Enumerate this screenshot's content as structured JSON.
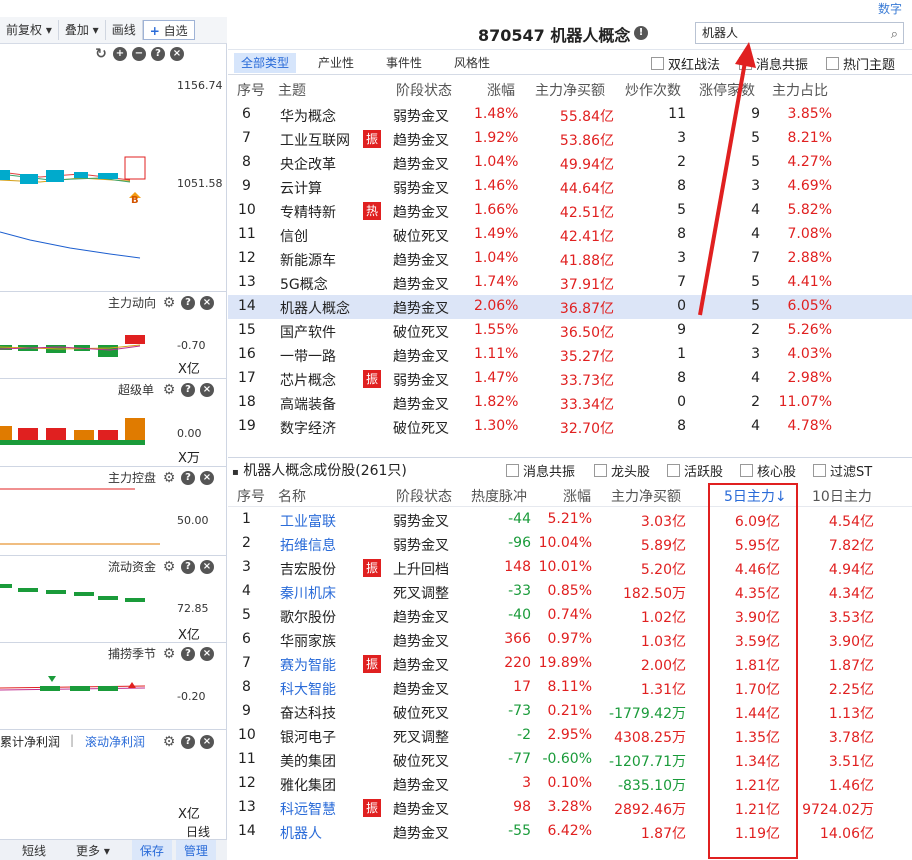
{
  "top_right_label": "数字",
  "left_toolbar": {
    "buttons": [
      "前复权 ▾",
      "叠加 ▾",
      "画线",
      "自选"
    ],
    "plus": "+"
  },
  "left_panel": {
    "price_top": "1156.74",
    "price_mid": "1051.58",
    "marker_b": "B",
    "sections": [
      {
        "title": "主力动向",
        "value": "-0.70",
        "unit": "X亿"
      },
      {
        "title": "超级单",
        "value": "0.00",
        "unit": "X万"
      },
      {
        "title": "主力控盘",
        "value": "50.00",
        "unit": ""
      },
      {
        "title": "流动资金",
        "value": "72.85",
        "unit": "X亿"
      },
      {
        "title": "捕捞季节",
        "value": "-0.20",
        "unit": ""
      }
    ],
    "profit_tabs": [
      "累计净利润",
      "滚动净利润"
    ],
    "profit_unit": "X亿",
    "period_label": "日线",
    "bottom": {
      "short": "短线",
      "more": "更多 ▾",
      "save": "保存",
      "manage": "管理"
    }
  },
  "header": {
    "title": "870547 机器人概念",
    "search_value": "机器人"
  },
  "tabs": [
    "全部类型",
    "产业性",
    "事件性",
    "风格性"
  ],
  "filters": [
    "双红战法",
    "消息共振",
    "热门主题"
  ],
  "table1": {
    "columns": [
      "序号",
      "主题",
      "阶段状态",
      "涨幅",
      "主力净买额",
      "炒作次数",
      "涨停家数",
      "主力占比"
    ],
    "rows": [
      {
        "no": "6",
        "name": "华为概念",
        "badge": "",
        "stage": "弱势金叉",
        "pct": "1.48%",
        "net": "55.84亿",
        "times": "11",
        "limit": "9",
        "ratio": "3.85%"
      },
      {
        "no": "7",
        "name": "工业互联网",
        "badge": "振",
        "stage": "趋势金叉",
        "pct": "1.92%",
        "net": "53.86亿",
        "times": "3",
        "limit": "5",
        "ratio": "8.21%"
      },
      {
        "no": "8",
        "name": "央企改革",
        "badge": "",
        "stage": "趋势金叉",
        "pct": "1.04%",
        "net": "49.94亿",
        "times": "2",
        "limit": "5",
        "ratio": "4.27%"
      },
      {
        "no": "9",
        "name": "云计算",
        "badge": "",
        "stage": "弱势金叉",
        "pct": "1.46%",
        "net": "44.64亿",
        "times": "8",
        "limit": "3",
        "ratio": "4.69%"
      },
      {
        "no": "10",
        "name": "专精特新",
        "badge": "热",
        "stage": "趋势金叉",
        "pct": "1.66%",
        "net": "42.51亿",
        "times": "5",
        "limit": "4",
        "ratio": "5.82%"
      },
      {
        "no": "11",
        "name": "信创",
        "badge": "",
        "stage": "破位死叉",
        "pct": "1.49%",
        "net": "42.41亿",
        "times": "8",
        "limit": "4",
        "ratio": "7.08%"
      },
      {
        "no": "12",
        "name": "新能源车",
        "badge": "",
        "stage": "趋势金叉",
        "pct": "1.04%",
        "net": "41.88亿",
        "times": "3",
        "limit": "7",
        "ratio": "2.88%"
      },
      {
        "no": "13",
        "name": "5G概念",
        "badge": "",
        "stage": "趋势金叉",
        "pct": "1.74%",
        "net": "37.91亿",
        "times": "7",
        "limit": "5",
        "ratio": "4.41%"
      },
      {
        "no": "14",
        "name": "机器人概念",
        "badge": "",
        "stage": "趋势金叉",
        "pct": "2.06%",
        "net": "36.87亿",
        "times": "0",
        "limit": "5",
        "ratio": "6.05%"
      },
      {
        "no": "15",
        "name": "国产软件",
        "badge": "",
        "stage": "破位死叉",
        "pct": "1.55%",
        "net": "36.50亿",
        "times": "9",
        "limit": "2",
        "ratio": "5.26%"
      },
      {
        "no": "16",
        "name": "一带一路",
        "badge": "",
        "stage": "趋势金叉",
        "pct": "1.11%",
        "net": "35.27亿",
        "times": "1",
        "limit": "3",
        "ratio": "4.03%"
      },
      {
        "no": "17",
        "name": "芯片概念",
        "badge": "振",
        "stage": "弱势金叉",
        "pct": "1.47%",
        "net": "33.73亿",
        "times": "8",
        "limit": "4",
        "ratio": "2.98%"
      },
      {
        "no": "18",
        "name": "高端装备",
        "badge": "",
        "stage": "趋势金叉",
        "pct": "1.82%",
        "net": "33.34亿",
        "times": "0",
        "limit": "2",
        "ratio": "11.07%"
      },
      {
        "no": "19",
        "name": "数字经济",
        "badge": "",
        "stage": "破位死叉",
        "pct": "1.30%",
        "net": "32.70亿",
        "times": "8",
        "limit": "4",
        "ratio": "4.78%"
      }
    ]
  },
  "sub": {
    "title": "机器人概念成份股(261只)",
    "filters": [
      "消息共振",
      "龙头股",
      "活跃股",
      "核心股",
      "过滤ST"
    ]
  },
  "table2": {
    "columns": [
      "序号",
      "名称",
      "阶段状态",
      "热度脉冲",
      "涨幅",
      "主力净买额",
      "5日主力↓",
      "10日主力"
    ],
    "rows": [
      {
        "no": "1",
        "name": "工业富联",
        "blue": true,
        "badge": "",
        "stage": "弱势金叉",
        "heat": "-44",
        "pct": "5.21%",
        "net": "3.03亿",
        "d5": "6.09亿",
        "d10": "4.54亿"
      },
      {
        "no": "2",
        "name": "拓维信息",
        "blue": true,
        "badge": "",
        "stage": "弱势金叉",
        "heat": "-96",
        "pct": "10.04%",
        "net": "5.89亿",
        "d5": "5.95亿",
        "d10": "7.82亿"
      },
      {
        "no": "3",
        "name": "吉宏股份",
        "blue": false,
        "badge": "振",
        "stage": "上升回档",
        "heat": "148",
        "pct": "10.01%",
        "net": "5.20亿",
        "d5": "4.46亿",
        "d10": "4.94亿"
      },
      {
        "no": "4",
        "name": "秦川机床",
        "blue": true,
        "badge": "",
        "stage": "死叉调整",
        "heat": "-33",
        "pct": "0.85%",
        "net": "182.50万",
        "d5": "4.35亿",
        "d10": "4.34亿"
      },
      {
        "no": "5",
        "name": "歌尔股份",
        "blue": false,
        "badge": "",
        "stage": "趋势金叉",
        "heat": "-40",
        "pct": "0.74%",
        "net": "1.02亿",
        "d5": "3.90亿",
        "d10": "3.53亿"
      },
      {
        "no": "6",
        "name": "华丽家族",
        "blue": false,
        "badge": "",
        "stage": "趋势金叉",
        "heat": "366",
        "pct": "0.97%",
        "net": "1.03亿",
        "d5": "3.59亿",
        "d10": "3.90亿"
      },
      {
        "no": "7",
        "name": "赛为智能",
        "blue": true,
        "badge": "振",
        "stage": "趋势金叉",
        "heat": "220",
        "pct": "19.89%",
        "net": "2.00亿",
        "d5": "1.81亿",
        "d10": "1.87亿"
      },
      {
        "no": "8",
        "name": "科大智能",
        "blue": true,
        "badge": "",
        "stage": "趋势金叉",
        "heat": "17",
        "pct": "8.11%",
        "net": "1.31亿",
        "d5": "1.70亿",
        "d10": "2.25亿"
      },
      {
        "no": "9",
        "name": "奋达科技",
        "blue": false,
        "badge": "",
        "stage": "破位死叉",
        "heat": "-73",
        "pct": "0.21%",
        "net": "-1779.42万",
        "d5": "1.44亿",
        "d10": "1.13亿"
      },
      {
        "no": "10",
        "name": "银河电子",
        "blue": false,
        "badge": "",
        "stage": "死叉调整",
        "heat": "-2",
        "pct": "2.95%",
        "net": "4308.25万",
        "d5": "1.35亿",
        "d10": "3.78亿"
      },
      {
        "no": "11",
        "name": "美的集团",
        "blue": false,
        "badge": "",
        "stage": "破位死叉",
        "heat": "-77",
        "pct": "-0.60%",
        "net": "-1207.71万",
        "d5": "1.34亿",
        "d10": "3.51亿"
      },
      {
        "no": "12",
        "name": "雅化集团",
        "blue": false,
        "badge": "",
        "stage": "趋势金叉",
        "heat": "3",
        "pct": "0.10%",
        "net": "-835.10万",
        "d5": "1.21亿",
        "d10": "1.46亿"
      },
      {
        "no": "13",
        "name": "科远智慧",
        "blue": true,
        "badge": "振",
        "stage": "趋势金叉",
        "heat": "98",
        "pct": "3.28%",
        "net": "2892.46万",
        "d5": "1.21亿",
        "d10": "9724.02万"
      },
      {
        "no": "14",
        "name": "机器人",
        "blue": true,
        "badge": "",
        "stage": "趋势金叉",
        "heat": "-55",
        "pct": "6.42%",
        "net": "1.87亿",
        "d5": "1.19亿",
        "d10": "14.06亿"
      }
    ]
  }
}
